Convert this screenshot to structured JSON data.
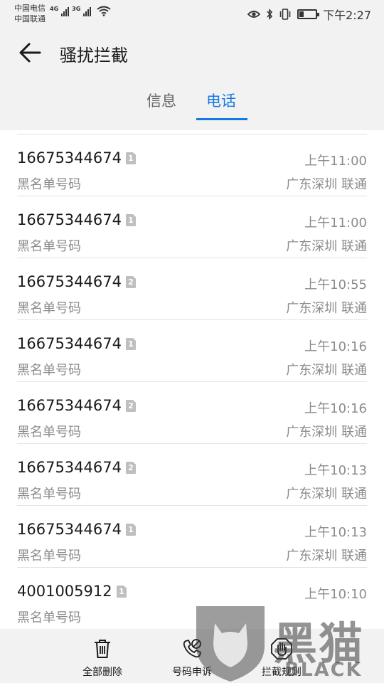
{
  "status_bar": {
    "carrier_1": "中国电信",
    "carrier_2": "中国联通",
    "net_1": "4G",
    "net_2": "3G",
    "time": "下午2:27",
    "battery_level": 0.25
  },
  "header": {
    "title": "骚扰拦截",
    "tabs": [
      {
        "label": "信息",
        "active": false
      },
      {
        "label": "电话",
        "active": true
      }
    ]
  },
  "calls": [
    {
      "number": "16675344674",
      "sim": "1",
      "type": "黑名单号码",
      "time": "上午11:00",
      "location": "广东深圳 联通"
    },
    {
      "number": "16675344674",
      "sim": "1",
      "type": "黑名单号码",
      "time": "上午11:00",
      "location": "广东深圳 联通"
    },
    {
      "number": "16675344674",
      "sim": "2",
      "type": "黑名单号码",
      "time": "上午10:55",
      "location": "广东深圳 联通"
    },
    {
      "number": "16675344674",
      "sim": "1",
      "type": "黑名单号码",
      "time": "上午10:16",
      "location": "广东深圳 联通"
    },
    {
      "number": "16675344674",
      "sim": "2",
      "type": "黑名单号码",
      "time": "上午10:16",
      "location": "广东深圳 联通"
    },
    {
      "number": "16675344674",
      "sim": "2",
      "type": "黑名单号码",
      "time": "上午10:13",
      "location": "广东深圳 联通"
    },
    {
      "number": "16675344674",
      "sim": "1",
      "type": "黑名单号码",
      "time": "上午10:13",
      "location": "广东深圳 联通"
    },
    {
      "number": "4001005912",
      "sim": "1",
      "type": "黑名单号码",
      "time": "上午10:10",
      "location": ""
    }
  ],
  "bottom_bar": {
    "delete_all": "全部删除",
    "number_appeal": "号码申诉",
    "block_rules": "拦截规则"
  },
  "watermark": {
    "cn": "黑猫",
    "en": "BLACK CAT"
  },
  "colors": {
    "accent": "#1677e5",
    "secondary_text": "#8c8c8c",
    "background_gray": "#f2f2f2"
  }
}
